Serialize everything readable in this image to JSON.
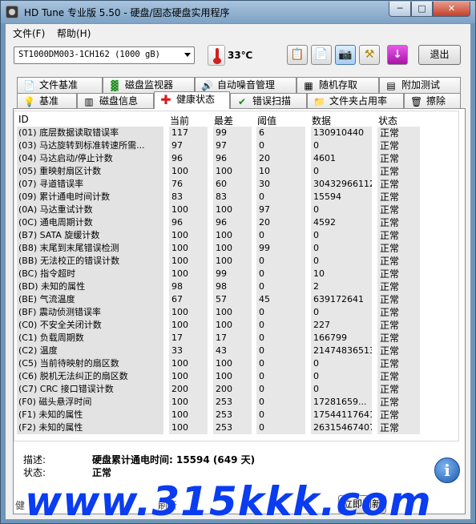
{
  "window": {
    "title": "HD Tune 专业版 5.50 - 硬盘/固态硬盘实用程序",
    "min": "─",
    "max": "□",
    "close": "✕"
  },
  "menu": {
    "file": "文件(F)",
    "help": "帮助(H)"
  },
  "toolbar": {
    "drive": "ST1000DM003-1CH162 (1000 gB)",
    "temperature": "33℃",
    "exit": "退出",
    "icons": [
      "copy-info-icon",
      "copy-screen-icon",
      "screenshot-camera-icon",
      "options-tools-icon",
      "save-download-icon"
    ]
  },
  "tabs_top": [
    "文件基准",
    "磁盘监视器",
    "自动噪音管理",
    "随机存取",
    "附加测试"
  ],
  "tabs_bottom": [
    "基准",
    "磁盘信息",
    "健康状态",
    "错误扫描",
    "文件夹占用率",
    "擦除"
  ],
  "active_tab": "健康状态",
  "columns": {
    "id": "ID",
    "current": "当前",
    "worst": "最差",
    "threshold": "阈值",
    "data": "数据",
    "status": "状态"
  },
  "rows": [
    {
      "id": "(01) 底层数据读取错误率",
      "current": "117",
      "worst": "99",
      "threshold": "6",
      "data": "130910440",
      "status": "正常"
    },
    {
      "id": "(03) 马达旋转到标准转速所需...",
      "current": "97",
      "worst": "97",
      "threshold": "0",
      "data": "0",
      "status": "正常"
    },
    {
      "id": "(04) 马达启动/停止计数",
      "current": "96",
      "worst": "96",
      "threshold": "20",
      "data": "4601",
      "status": "正常"
    },
    {
      "id": "(05) 重映射扇区计数",
      "current": "100",
      "worst": "100",
      "threshold": "10",
      "data": "0",
      "status": "正常"
    },
    {
      "id": "(07) 寻道错误率",
      "current": "76",
      "worst": "60",
      "threshold": "30",
      "data": "30432966112",
      "status": "正常"
    },
    {
      "id": "(09) 累计通电时间计数",
      "current": "83",
      "worst": "83",
      "threshold": "0",
      "data": "15594",
      "status": "正常"
    },
    {
      "id": "(0A) 马达重试计数",
      "current": "100",
      "worst": "100",
      "threshold": "97",
      "data": "0",
      "status": "正常"
    },
    {
      "id": "(0C) 通电周期计数",
      "current": "96",
      "worst": "96",
      "threshold": "20",
      "data": "4592",
      "status": "正常"
    },
    {
      "id": "(B7) SATA 旋缓计数",
      "current": "100",
      "worst": "100",
      "threshold": "0",
      "data": "0",
      "status": "正常"
    },
    {
      "id": "(B8) 末尾到末尾错误检测",
      "current": "100",
      "worst": "100",
      "threshold": "99",
      "data": "0",
      "status": "正常"
    },
    {
      "id": "(BB) 无法校正的错误计数",
      "current": "100",
      "worst": "100",
      "threshold": "0",
      "data": "0",
      "status": "正常"
    },
    {
      "id": "(BC) 指令超时",
      "current": "100",
      "worst": "99",
      "threshold": "0",
      "data": "10",
      "status": "正常"
    },
    {
      "id": "(BD) 未知的属性",
      "current": "98",
      "worst": "98",
      "threshold": "0",
      "data": "2",
      "status": "正常"
    },
    {
      "id": "(BE) 气流温度",
      "current": "67",
      "worst": "57",
      "threshold": "45",
      "data": "639172641",
      "status": "正常"
    },
    {
      "id": "(BF) 震动侦测错误率",
      "current": "100",
      "worst": "100",
      "threshold": "0",
      "data": "0",
      "status": "正常"
    },
    {
      "id": "(C0) 不安全关闭计数",
      "current": "100",
      "worst": "100",
      "threshold": "0",
      "data": "227",
      "status": "正常"
    },
    {
      "id": "(C1) 负载周期数",
      "current": "17",
      "worst": "17",
      "threshold": "0",
      "data": "166799",
      "status": "正常"
    },
    {
      "id": "(C2) 温度",
      "current": "33",
      "worst": "43",
      "threshold": "0",
      "data": "21474836513",
      "status": "正常"
    },
    {
      "id": "(C5) 当前待映射的扇区数",
      "current": "100",
      "worst": "100",
      "threshold": "0",
      "data": "0",
      "status": "正常"
    },
    {
      "id": "(C6) 脱机无法纠正的扇区数",
      "current": "100",
      "worst": "100",
      "threshold": "0",
      "data": "0",
      "status": "正常"
    },
    {
      "id": "(C7) CRC 接口错误计数",
      "current": "200",
      "worst": "200",
      "threshold": "0",
      "data": "0",
      "status": "正常"
    },
    {
      "id": "(F0) 磁头悬浮时间",
      "current": "100",
      "worst": "253",
      "threshold": "0",
      "data": "17281659...",
      "status": "正常"
    },
    {
      "id": "(F1) 未知的属性",
      "current": "100",
      "worst": "253",
      "threshold": "0",
      "data": "17544117641",
      "status": "正常"
    },
    {
      "id": "(F2) 未知的属性",
      "current": "100",
      "worst": "253",
      "threshold": "0",
      "data": "26315467407",
      "status": "正常"
    }
  ],
  "description": {
    "desc_label": "描述:",
    "desc_value": "硬盘累计通电时间: 15594 (649 天)",
    "status_label": "状态:",
    "status_value": "正常"
  },
  "bottom": {
    "left": "健",
    "mid": "刷新",
    "refresh": "立即刷新"
  },
  "watermark": "www.315kkk.com"
}
